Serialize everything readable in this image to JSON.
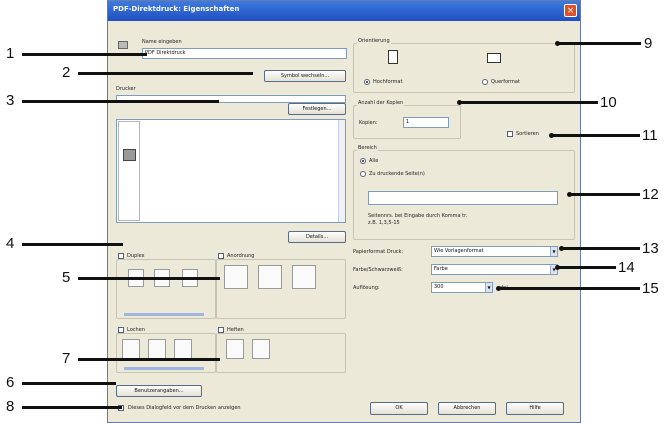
{
  "window": {
    "title": "PDF-Direktdruck: Eigenschaften",
    "close_glyph": "×"
  },
  "left": {
    "name_label": "Name eingeben",
    "name_value": "PDF Direktdruck",
    "symbol_button": "Symbol wechseln...",
    "printer_label": "Drucker",
    "add_button": "Festlegen...",
    "details_button": "Details...",
    "duplex_label": "Duplex",
    "arrangement_label": "Anordnung",
    "punch_label": "Lochen",
    "staple_label": "Heften",
    "user_button": "Benutzerangaben...",
    "show_dialog_label": "Dieses Dialogfeld vor dem Drucken anzeigen"
  },
  "right": {
    "orientation_label": "Orientierung",
    "portrait_label": "Hochformat",
    "landscape_label": "Querformat",
    "copies_group_label": "Anzahl der Kopien",
    "copies_label": "Kopien:",
    "copies_value": "1",
    "sort_label": "Sortieren",
    "range_label": "Bereich",
    "all_label": "Alle",
    "pages_label": "Zu druckende Seite(n)",
    "range_hint_1": "Seitennrs. bei Eingabe durch Komma tr.",
    "range_hint_2": "z.B. 1,3,5-15",
    "paper_label": "Papierformat Druck:",
    "paper_value": "Wie Vorlagenformat",
    "color_label": "Farbe/Schwarzweiß:",
    "color_value": "Farbe",
    "copies2_label": "Auflösung:",
    "copies2_value": "300",
    "dpi_label": "dpi"
  },
  "buttons": {
    "ok": "OK",
    "cancel": "Abbrechen",
    "help": "Hilfe"
  },
  "callouts": {
    "n1": "1",
    "n2": "2",
    "n3": "3",
    "n4": "4",
    "n5": "5",
    "n6": "6",
    "n7": "7",
    "n8": "8",
    "n9": "9",
    "n10": "10",
    "n11": "11",
    "n12": "12",
    "n13": "13",
    "n14": "14",
    "n15": "15"
  }
}
